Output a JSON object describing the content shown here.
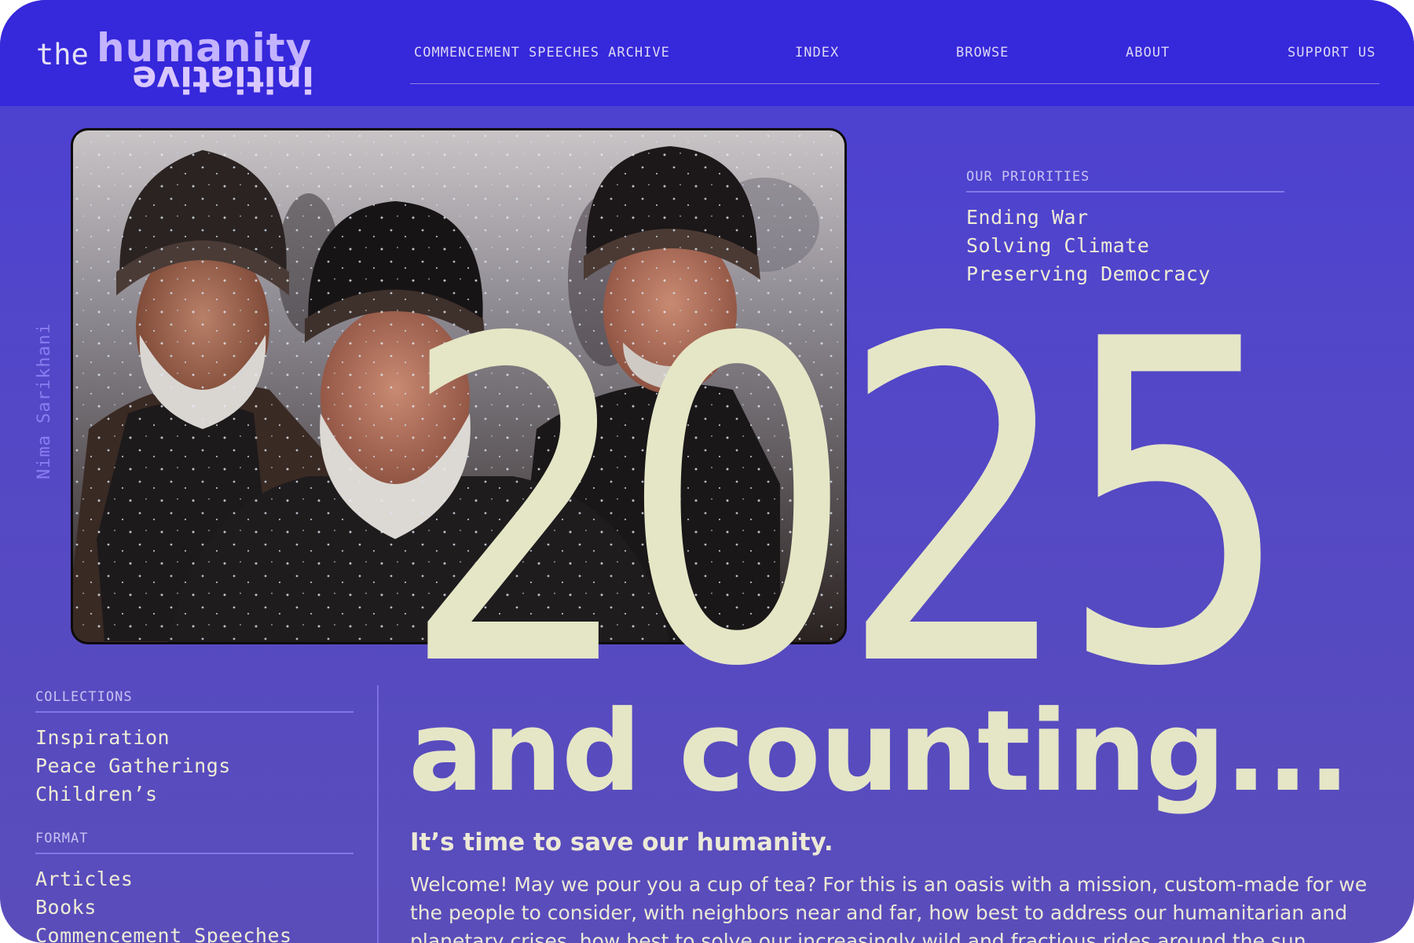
{
  "brand": {
    "logo_the": "the",
    "logo_humanity": "humanity",
    "logo_initiative": "initiative"
  },
  "nav": {
    "items": [
      {
        "label": "COMMENCEMENT SPEECHES ARCHIVE"
      },
      {
        "label": "INDEX"
      },
      {
        "label": "BROWSE"
      },
      {
        "label": "ABOUT"
      },
      {
        "label": "SUPPORT US"
      }
    ]
  },
  "photo": {
    "credit": "Nima Sarikhani"
  },
  "priorities": {
    "heading": "OUR PRIORITIES",
    "items": [
      "Ending War",
      "Solving Climate",
      "Preserving Democracy"
    ]
  },
  "hero": {
    "year": "2025",
    "subtitle": "and counting...",
    "tagline": "It’s time to save our humanity.",
    "intro": "Welcome! May we pour you a cup of tea? For this is an oasis with a mission, custom-made for we the people to consider, with neighbors near and far, how best to address our humanitarian and planetary crises, how best to solve our increasingly wild and fractious rides around the sun."
  },
  "collections": {
    "heading": "COLLECTIONS",
    "items": [
      "Inspiration",
      "Peace Gatherings",
      "Children’s"
    ]
  },
  "format": {
    "heading": "FORMAT",
    "items": [
      "Articles",
      "Books",
      "Commencement Speeches"
    ]
  },
  "colors": {
    "header_bg": "#3628db",
    "page_bg": "#5448c6",
    "cream": "#e5e6c6",
    "accent_lilac": "#c3b3ff"
  }
}
